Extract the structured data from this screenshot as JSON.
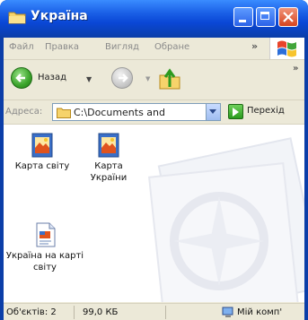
{
  "window": {
    "title": "Україна"
  },
  "menu": {
    "items": [
      "Файл",
      "Правка",
      "Вигляд",
      "Обране"
    ],
    "more": "»"
  },
  "toolbar": {
    "back_label": "Назад",
    "more": "»"
  },
  "address": {
    "label": "Адреса:",
    "value": "C:\\Documents and",
    "go_label": "Перехід"
  },
  "files": [
    {
      "name": "Карта світу",
      "icon": "bitmap-image-icon"
    },
    {
      "name": "Карта України",
      "icon": "bitmap-image-icon"
    },
    {
      "name": "Україна на карті світу",
      "icon": "document-icon"
    }
  ],
  "status": {
    "objects": "Об'єктів: 2",
    "size": "99,0 КБ",
    "location": "Мій комп'"
  },
  "colors": {
    "title_bar": "#0b3ea8",
    "close_button": "#d6441f",
    "chrome": "#ece9d8"
  }
}
